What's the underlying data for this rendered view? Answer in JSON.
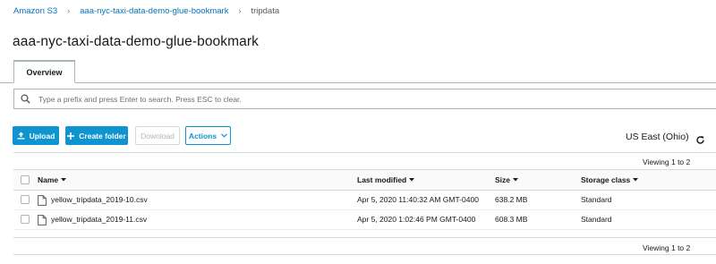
{
  "breadcrumb": {
    "items": [
      {
        "label": "Amazon S3"
      },
      {
        "label": "aaa-nyc-taxi-data-demo-glue-bookmark"
      },
      {
        "label": "tripdata"
      }
    ]
  },
  "page": {
    "title": "aaa-nyc-taxi-data-demo-glue-bookmark"
  },
  "tabs": [
    {
      "label": "Overview"
    }
  ],
  "search": {
    "placeholder": "Type a prefix and press Enter to search. Press ESC to clear."
  },
  "toolbar": {
    "upload_label": "Upload",
    "create_folder_label": "Create folder",
    "download_label": "Download",
    "actions_label": "Actions",
    "region": "US East (Ohio)"
  },
  "table": {
    "viewing": "Viewing 1 to 2",
    "columns": [
      "Name",
      "Last modified",
      "Size",
      "Storage class"
    ],
    "rows": [
      {
        "name": "yellow_tripdata_2019-10.csv",
        "last_modified": "Apr 5, 2020 11:40:32 AM GMT-0400",
        "size": "638.2 MB",
        "storage_class": "Standard"
      },
      {
        "name": "yellow_tripdata_2019-11.csv",
        "last_modified": "Apr 5, 2020 1:02:46 PM GMT-0400",
        "size": "608.3 MB",
        "storage_class": "Standard"
      }
    ]
  },
  "colors": {
    "link": "#0073bb",
    "primary_button": "#0e95d1",
    "border": "#aab7b8"
  },
  "icons": [
    "chevron-right-icon",
    "search-icon",
    "upload-icon",
    "plus-icon",
    "chevron-down-icon",
    "refresh-icon",
    "file-icon",
    "sort-caret-icon"
  ]
}
